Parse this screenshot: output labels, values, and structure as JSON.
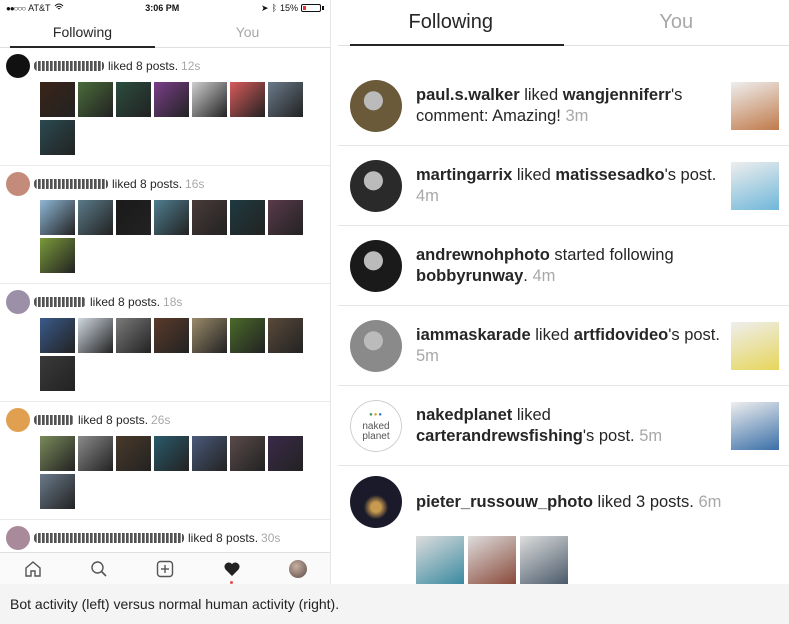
{
  "left": {
    "status": {
      "carrier": "AT&T",
      "time": "3:06 PM",
      "battery": "15%"
    },
    "tabs": {
      "following": "Following",
      "you": "You"
    },
    "items": [
      {
        "text": "liked 8 posts.",
        "time": "12s",
        "avatar": "#111111",
        "scribble_w": 70,
        "thumbs": [
          "#3a2418",
          "#4a6b3a",
          "#2b4d3f",
          "#7a3f8a",
          "#cfcfcf",
          "#d85a5a",
          "#6a7a8a",
          "#2a4a50"
        ]
      },
      {
        "text": "liked 8 posts.",
        "time": "16s",
        "avatar": "#c48a7a",
        "scribble_w": 74,
        "thumbs": [
          "#8fb7d6",
          "#5a7a88",
          "#1a1a1a",
          "#4f7d8f",
          "#4a3a3a",
          "#1e3a40",
          "#5a3a4a",
          "#7a9a3a"
        ]
      },
      {
        "text": "liked 8 posts.",
        "time": "18s",
        "avatar": "#9c8fa8",
        "scribble_w": 52,
        "thumbs": [
          "#3a5a8a",
          "#d0d8e0",
          "#7a7a7a",
          "#5a3a2a",
          "#9a8a6a",
          "#4a6a2a",
          "#5a4a3a",
          "#3a3a3a"
        ]
      },
      {
        "text": "liked 8 posts.",
        "time": "26s",
        "avatar": "#e0a050",
        "scribble_w": 40,
        "thumbs": [
          "#7a8a5a",
          "#8a8a8a",
          "#4a3a2a",
          "#2a5a6a",
          "#4a5a7a",
          "#5a4a4a",
          "#3a2a4a",
          "#6a7a8a"
        ]
      },
      {
        "text": "liked 8 posts.",
        "time": "30s",
        "avatar": "#a88a9a",
        "scribble_w": 150,
        "thumbs": [
          "#d0d0d0",
          "#c0c0c0",
          "#b0b0b0",
          "#c8c8c8",
          "#d8d8d8",
          "#c0c0c0",
          "#b8b8b8",
          "#c8c8c8"
        ]
      }
    ]
  },
  "right": {
    "tabs": {
      "following": "Following",
      "you": "You"
    },
    "items": [
      {
        "user": "paul.s.walker",
        "mid": " liked ",
        "target": "wangjenniferr",
        "rest": "'s comment: Amazing! ",
        "time": "3m",
        "avatar": "#6a5a3a",
        "thumb": "#c07a4a"
      },
      {
        "user": "martingarrix",
        "mid": " liked ",
        "target": "matissesadko",
        "rest": "'s post. ",
        "time": "4m",
        "avatar": "#2a2a2a",
        "thumb": "#6fb7d9"
      },
      {
        "user": "andrewnohphoto",
        "mid": " started following ",
        "target": "bobbyrunway",
        "rest": ". ",
        "time": "4m",
        "avatar": "#1a1a1a",
        "thumb": ""
      },
      {
        "user": "iammaskarade",
        "mid": " liked ",
        "target": "artfidovideo",
        "rest": "'s post. ",
        "time": "5m",
        "avatar": "#8a8a8a",
        "thumb": "#e6d65a"
      },
      {
        "user": "nakedplanet",
        "mid": " liked ",
        "target": "carterandrewsfishing",
        "rest": "'s post. ",
        "time": "5m",
        "avatar": "logo",
        "logo_line1": "naked",
        "logo_line2": "planet",
        "thumb": "#3a6fa8"
      }
    ],
    "last": {
      "user": "pieter_russouw_photo",
      "text": " liked 3 posts. ",
      "time": "6m",
      "avatar": "#1a1a2a",
      "thumbs": [
        "#3a8aa0",
        "#8a4a3a",
        "#4a5a6a"
      ]
    }
  },
  "caption": "Bot activity (left) versus normal human activity (right)."
}
